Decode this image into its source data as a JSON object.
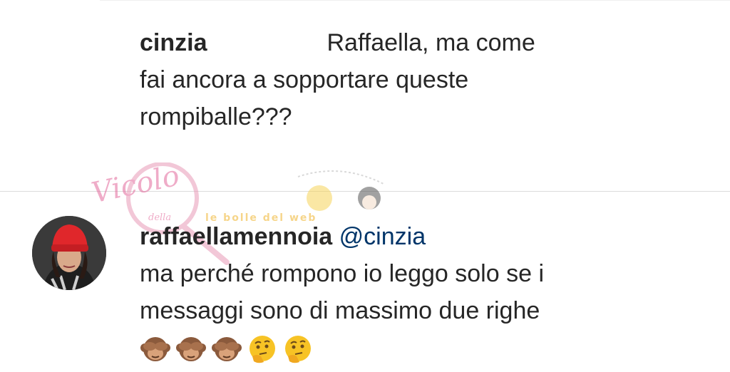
{
  "comment1": {
    "username": "cinzia",
    "text_line1_end": "Raffaella, ma come",
    "text_line2": "fai ancora a sopportare queste",
    "text_line3": "rompiballe???"
  },
  "comment2": {
    "username": "raffaellamennoia",
    "mention": "@cinzia",
    "text_line1": "ma perché rompono io leggo solo se i",
    "text_line2": "messaggi sono di massimo due righe",
    "emojis": [
      "see-no-evil-monkey",
      "see-no-evil-monkey",
      "see-no-evil-monkey",
      "thinking-face",
      "thinking-face"
    ]
  },
  "watermark": {
    "script": "Vicolo",
    "della": "della",
    "banner": "le bolle del web"
  }
}
